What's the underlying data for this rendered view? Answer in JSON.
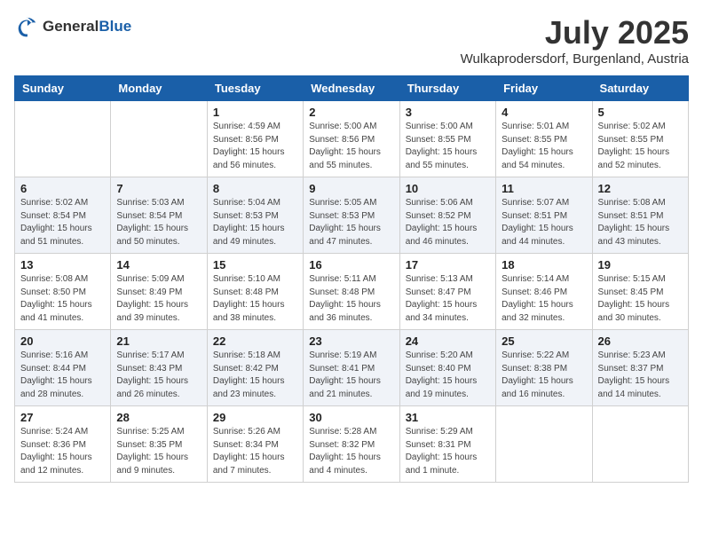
{
  "logo": {
    "general": "General",
    "blue": "Blue"
  },
  "title": "July 2025",
  "location": "Wulkaprodersdorf, Burgenland, Austria",
  "headers": [
    "Sunday",
    "Monday",
    "Tuesday",
    "Wednesday",
    "Thursday",
    "Friday",
    "Saturday"
  ],
  "weeks": [
    [
      {
        "day": "",
        "info": ""
      },
      {
        "day": "",
        "info": ""
      },
      {
        "day": "1",
        "info": "Sunrise: 4:59 AM\nSunset: 8:56 PM\nDaylight: 15 hours and 56 minutes."
      },
      {
        "day": "2",
        "info": "Sunrise: 5:00 AM\nSunset: 8:56 PM\nDaylight: 15 hours and 55 minutes."
      },
      {
        "day": "3",
        "info": "Sunrise: 5:00 AM\nSunset: 8:55 PM\nDaylight: 15 hours and 55 minutes."
      },
      {
        "day": "4",
        "info": "Sunrise: 5:01 AM\nSunset: 8:55 PM\nDaylight: 15 hours and 54 minutes."
      },
      {
        "day": "5",
        "info": "Sunrise: 5:02 AM\nSunset: 8:55 PM\nDaylight: 15 hours and 52 minutes."
      }
    ],
    [
      {
        "day": "6",
        "info": "Sunrise: 5:02 AM\nSunset: 8:54 PM\nDaylight: 15 hours and 51 minutes."
      },
      {
        "day": "7",
        "info": "Sunrise: 5:03 AM\nSunset: 8:54 PM\nDaylight: 15 hours and 50 minutes."
      },
      {
        "day": "8",
        "info": "Sunrise: 5:04 AM\nSunset: 8:53 PM\nDaylight: 15 hours and 49 minutes."
      },
      {
        "day": "9",
        "info": "Sunrise: 5:05 AM\nSunset: 8:53 PM\nDaylight: 15 hours and 47 minutes."
      },
      {
        "day": "10",
        "info": "Sunrise: 5:06 AM\nSunset: 8:52 PM\nDaylight: 15 hours and 46 minutes."
      },
      {
        "day": "11",
        "info": "Sunrise: 5:07 AM\nSunset: 8:51 PM\nDaylight: 15 hours and 44 minutes."
      },
      {
        "day": "12",
        "info": "Sunrise: 5:08 AM\nSunset: 8:51 PM\nDaylight: 15 hours and 43 minutes."
      }
    ],
    [
      {
        "day": "13",
        "info": "Sunrise: 5:08 AM\nSunset: 8:50 PM\nDaylight: 15 hours and 41 minutes."
      },
      {
        "day": "14",
        "info": "Sunrise: 5:09 AM\nSunset: 8:49 PM\nDaylight: 15 hours and 39 minutes."
      },
      {
        "day": "15",
        "info": "Sunrise: 5:10 AM\nSunset: 8:48 PM\nDaylight: 15 hours and 38 minutes."
      },
      {
        "day": "16",
        "info": "Sunrise: 5:11 AM\nSunset: 8:48 PM\nDaylight: 15 hours and 36 minutes."
      },
      {
        "day": "17",
        "info": "Sunrise: 5:13 AM\nSunset: 8:47 PM\nDaylight: 15 hours and 34 minutes."
      },
      {
        "day": "18",
        "info": "Sunrise: 5:14 AM\nSunset: 8:46 PM\nDaylight: 15 hours and 32 minutes."
      },
      {
        "day": "19",
        "info": "Sunrise: 5:15 AM\nSunset: 8:45 PM\nDaylight: 15 hours and 30 minutes."
      }
    ],
    [
      {
        "day": "20",
        "info": "Sunrise: 5:16 AM\nSunset: 8:44 PM\nDaylight: 15 hours and 28 minutes."
      },
      {
        "day": "21",
        "info": "Sunrise: 5:17 AM\nSunset: 8:43 PM\nDaylight: 15 hours and 26 minutes."
      },
      {
        "day": "22",
        "info": "Sunrise: 5:18 AM\nSunset: 8:42 PM\nDaylight: 15 hours and 23 minutes."
      },
      {
        "day": "23",
        "info": "Sunrise: 5:19 AM\nSunset: 8:41 PM\nDaylight: 15 hours and 21 minutes."
      },
      {
        "day": "24",
        "info": "Sunrise: 5:20 AM\nSunset: 8:40 PM\nDaylight: 15 hours and 19 minutes."
      },
      {
        "day": "25",
        "info": "Sunrise: 5:22 AM\nSunset: 8:38 PM\nDaylight: 15 hours and 16 minutes."
      },
      {
        "day": "26",
        "info": "Sunrise: 5:23 AM\nSunset: 8:37 PM\nDaylight: 15 hours and 14 minutes."
      }
    ],
    [
      {
        "day": "27",
        "info": "Sunrise: 5:24 AM\nSunset: 8:36 PM\nDaylight: 15 hours and 12 minutes."
      },
      {
        "day": "28",
        "info": "Sunrise: 5:25 AM\nSunset: 8:35 PM\nDaylight: 15 hours and 9 minutes."
      },
      {
        "day": "29",
        "info": "Sunrise: 5:26 AM\nSunset: 8:34 PM\nDaylight: 15 hours and 7 minutes."
      },
      {
        "day": "30",
        "info": "Sunrise: 5:28 AM\nSunset: 8:32 PM\nDaylight: 15 hours and 4 minutes."
      },
      {
        "day": "31",
        "info": "Sunrise: 5:29 AM\nSunset: 8:31 PM\nDaylight: 15 hours and 1 minute."
      },
      {
        "day": "",
        "info": ""
      },
      {
        "day": "",
        "info": ""
      }
    ]
  ]
}
